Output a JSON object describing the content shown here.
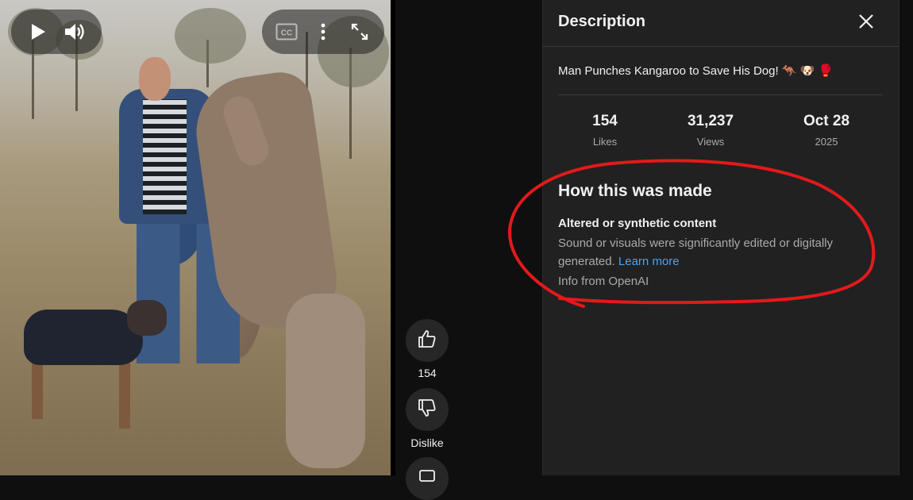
{
  "player": {
    "icons": {
      "play": "play-icon",
      "volume": "volume-icon",
      "captions": "closed-captions-icon",
      "more": "more-vert-icon",
      "fullscreen": "fullscreen-icon"
    },
    "captions_label": "CC"
  },
  "actions": {
    "like_count": "154",
    "dislike_label": "Dislike"
  },
  "description_panel": {
    "title": "Description",
    "video_title": "Man Punches Kangaroo to Save His Dog! 🦘 🐶 🥊",
    "stats": [
      {
        "value": "154",
        "label": "Likes"
      },
      {
        "value": "31,237",
        "label": "Views"
      },
      {
        "value": "Oct 28",
        "label": "2025"
      }
    ],
    "how_made": {
      "heading": "How this was made",
      "subheading": "Altered or synthetic content",
      "description": "Sound or visuals were significantly edited or digitally generated.",
      "link_text": "Learn more",
      "info": "Info from OpenAI"
    }
  },
  "colors": {
    "panel_bg": "#212121",
    "link": "#3ea6ff",
    "annotation": "#e3191c"
  }
}
